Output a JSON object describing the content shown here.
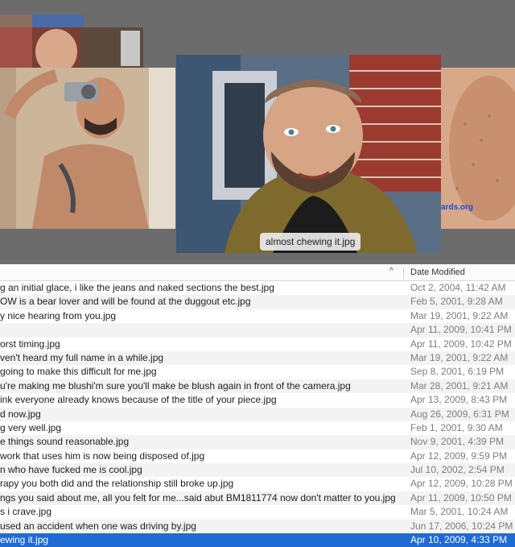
{
  "caption": "almost chewing it.jpg",
  "watermark": "ards.org",
  "header": {
    "sort_indicator": "^",
    "date_column": "Date Modified"
  },
  "files": [
    {
      "name": "g an initial glace, i like the jeans and naked sections the best.jpg",
      "date": "Oct 2, 2004, 11:42 AM"
    },
    {
      "name": "OW is a bear lover and will be found at the duggout etc.jpg",
      "date": "Feb 5, 2001, 9:28 AM"
    },
    {
      "name": "y nice hearing from you.jpg",
      "date": "Mar 19, 2001, 9:22 AM"
    },
    {
      "name": "",
      "date": "Apr 11, 2009, 10:41 PM"
    },
    {
      "name": "orst timing.jpg",
      "date": "Apr 11, 2009, 10:42 PM"
    },
    {
      "name": "ven't heard my full name in a while.jpg",
      "date": "Mar 19, 2001, 9:22 AM"
    },
    {
      "name": " going to make this difficult for me.jpg",
      "date": "Sep 8, 2001, 6:19 PM"
    },
    {
      "name": "u're making me blushi'm sure you'll make be blush again in front of the camera.jpg",
      "date": "Mar 28, 2001, 9:21 AM"
    },
    {
      "name": "ink everyone already knows because of the title of your piece.jpg",
      "date": "Apr 13, 2009, 8:43 PM"
    },
    {
      "name": "d now.jpg",
      "date": "Aug 26, 2009, 6:31 PM"
    },
    {
      "name": "g very well.jpg",
      "date": "Feb 1, 2001, 9:30 AM"
    },
    {
      "name": "e things sound reasonable.jpg",
      "date": "Nov 9, 2001, 4:39 PM"
    },
    {
      "name": "work that uses him is now being disposed of.jpg",
      "date": "Apr 12, 2009, 9:59 PM"
    },
    {
      "name": "n who have fucked me is cool.jpg",
      "date": "Jul 10, 2002, 2:54 PM"
    },
    {
      "name": "rapy you both did and the relationship still broke up.jpg",
      "date": "Apr 12, 2009, 10:28 PM"
    },
    {
      "name": "ngs you said about me, all you felt for me...said abut BM1811774 now don't matter to you.jpg",
      "date": "Apr 11, 2009, 10:50 PM"
    },
    {
      "name": "s i crave.jpg",
      "date": "Mar 5, 2001, 10:24 AM"
    },
    {
      "name": "used an accident when one was driving by.jpg",
      "date": "Jun 17, 2006, 10:24 PM"
    },
    {
      "name": "ewing it.jpg",
      "date": "Apr 10, 2009, 4:33 PM",
      "selected": true
    }
  ]
}
